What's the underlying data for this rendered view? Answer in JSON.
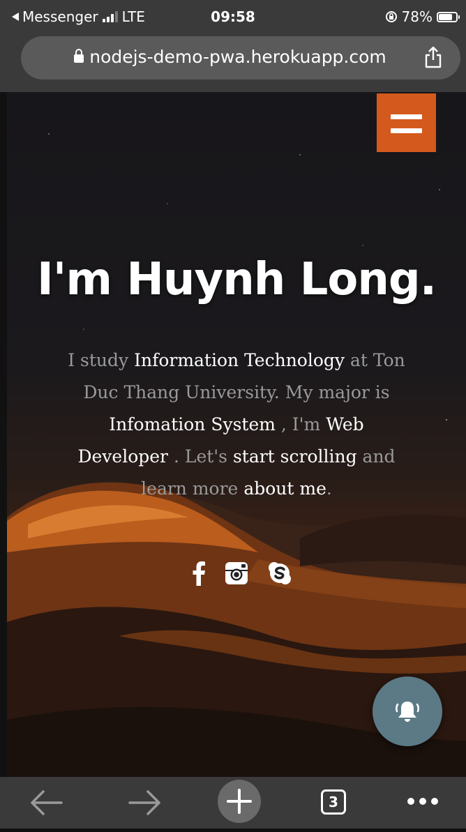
{
  "status_bar": {
    "back_app": "Messenger",
    "network": "LTE",
    "time": "09:58",
    "battery_percent": "78%",
    "battery_level": 0.78,
    "icons": [
      "back-arrow-icon",
      "signal-icon",
      "orientation-lock-icon",
      "battery-icon"
    ]
  },
  "browser": {
    "url": "nodejs-demo-pwa.herokuapp.com",
    "tab_count": "3",
    "icons": [
      "lock-icon",
      "share-icon",
      "back-arrow-icon",
      "forward-arrow-icon",
      "plus-icon",
      "tabs-icon",
      "more-icon"
    ]
  },
  "page": {
    "title": "I'm Huynh Long.",
    "description": [
      {
        "text": "I study ",
        "highlight": false
      },
      {
        "text": "Information Technology",
        "highlight": true
      },
      {
        "text": " at Ton Duc Thang University. My major is ",
        "highlight": false
      },
      {
        "text": "Infomation System",
        "highlight": true
      },
      {
        "text": " , I'm ",
        "highlight": false
      },
      {
        "text": "Web Developer",
        "highlight": true
      },
      {
        "text": " . Let's ",
        "highlight": false
      },
      {
        "text": "start scrolling",
        "highlight": true
      },
      {
        "text": " and learn more ",
        "highlight": false
      },
      {
        "text": "about me",
        "highlight": true
      },
      {
        "text": ".",
        "highlight": false
      }
    ],
    "social_icons": [
      "facebook-icon",
      "instagram-icon",
      "skype-icon"
    ],
    "accent_color": "#d35a1c",
    "fab_color": "#5b7a86",
    "icons": [
      "hamburger-menu-icon",
      "bell-icon"
    ]
  }
}
